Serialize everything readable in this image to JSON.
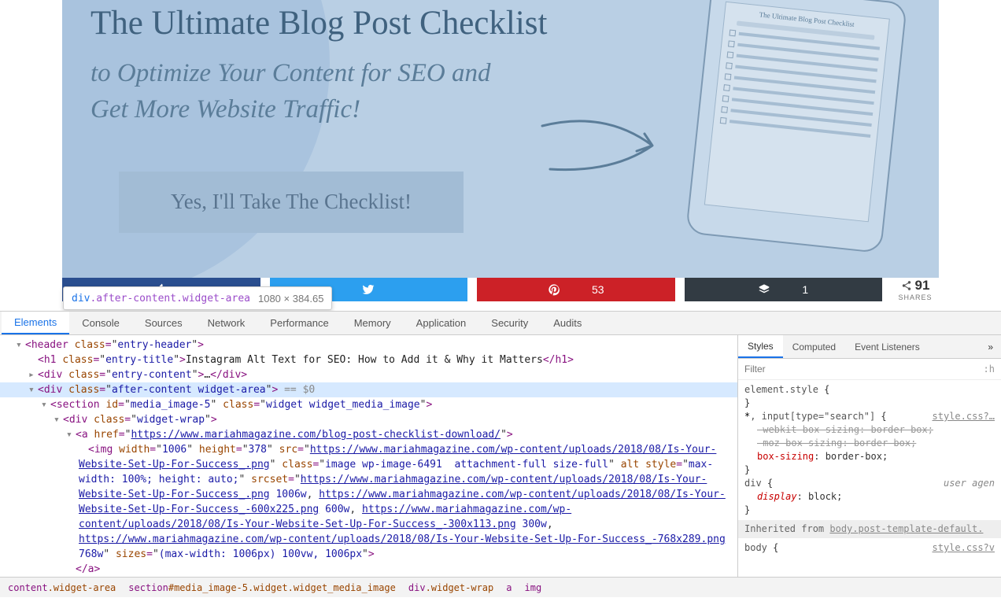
{
  "banner": {
    "title": "The Ultimate Blog Post Checklist",
    "subtitle": "to Optimize Your Content for SEO and\nGet More Website Traffic!",
    "button": "Yes, I'll Take The Checklist!",
    "tablet_title": "The Ultimate Blog Post Checklist"
  },
  "share": {
    "pinterest_count": "53",
    "buffer_count": "1",
    "total_num": "91",
    "total_label": "SHARES"
  },
  "tooltip": {
    "tag": "div",
    "cls": ".after-content.widget-area",
    "dims": "1080 × 384.65"
  },
  "devtools": {
    "tabs": [
      "Elements",
      "Console",
      "Sources",
      "Network",
      "Performance",
      "Memory",
      "Application",
      "Security",
      "Audits"
    ],
    "active_tab": 0,
    "side_tabs": [
      "Styles",
      "Computed",
      "Event Listeners"
    ],
    "side_active": 0,
    "filter_placeholder": "Filter",
    "filter_hint": ":h",
    "crumbs": [
      {
        "txt": "content.widget-area",
        "sel": false
      },
      {
        "txt": "section#media_image-5.widget.widget_media_image",
        "sel": false
      },
      {
        "txt": "div.widget-wrap",
        "sel": false
      },
      {
        "txt": "a",
        "sel": false
      },
      {
        "txt": "img",
        "sel": false
      }
    ],
    "dom": {
      "header_open": "<header class=\"entry-header\">",
      "h1_open": "<h1 class=\"entry-title\">",
      "h1_text": "Instagram Alt Text for SEO: How to Add it & Why it Matters",
      "h1_close": "</h1>",
      "entry_content": "<div class=\"entry-content\">…</div>",
      "after_content": "<div class=\"after-content widget-area\">",
      "after_content_suffix": " == $0",
      "section": "<section id=\"media_image-5\" class=\"widget widget_media_image\">",
      "widget_wrap": "<div class=\"widget-wrap\">",
      "a_open": "<a href=\"https://www.mariahmagazine.com/blog-post-checklist-download/\">",
      "img_w": "1006",
      "img_h": "378",
      "img_src": "https://www.mariahmagazine.com/wp-content/uploads/2018/08/Is-Your-Website-Set-Up-For-Success_.png",
      "img_class": "image wp-image-6491  attachment-full size-full",
      "img_style": "max-width: 100%; height: auto;",
      "srcset_1": "https://www.mariahmagazine.com/wp-content/uploads/2018/08/Is-Your-Website-Set-Up-For-Success_.png",
      "srcset_1w": "1006w",
      "srcset_2": "https://www.mariahmagazine.com/wp-content/uploads/2018/08/Is-Your-Website-Set-Up-For-Success_-600x225.png",
      "srcset_2w": "600w",
      "srcset_3": "https://www.mariahmagazine.com/wp-content/uploads/2018/08/Is-Your-Website-Set-Up-For-Success_-300x113.png",
      "srcset_3w": "300w",
      "srcset_4": "https://www.mariahmagazine.com/wp-content/uploads/2018/08/Is-Your-Website-Set-Up-For-Success_-768x289.png",
      "srcset_4w": "768w",
      "sizes": "(max-width: 1006px) 100vw, 1006px",
      "a_close": "</a>"
    },
    "styles": {
      "rules": [
        {
          "selector": "element.style",
          "src": "",
          "props": []
        },
        {
          "selector": "*, input[type=\"search\"]",
          "src": "style.css?…",
          "props": [
            {
              "name": "-webkit-box-sizing",
              "value": "border-box;",
              "strike": true
            },
            {
              "name": "-moz-box-sizing",
              "value": "border-box;",
              "strike": true
            },
            {
              "name": "box-sizing",
              "value": "border-box;",
              "strike": false
            }
          ]
        },
        {
          "selector": "div",
          "src": "user agen",
          "ua": true,
          "props": [
            {
              "name": "display",
              "value": "block;",
              "italic": true
            }
          ]
        }
      ],
      "inherited_from": "body.post-template-default.",
      "body_rule": {
        "selector": "body",
        "src": "style.css?v"
      }
    }
  }
}
